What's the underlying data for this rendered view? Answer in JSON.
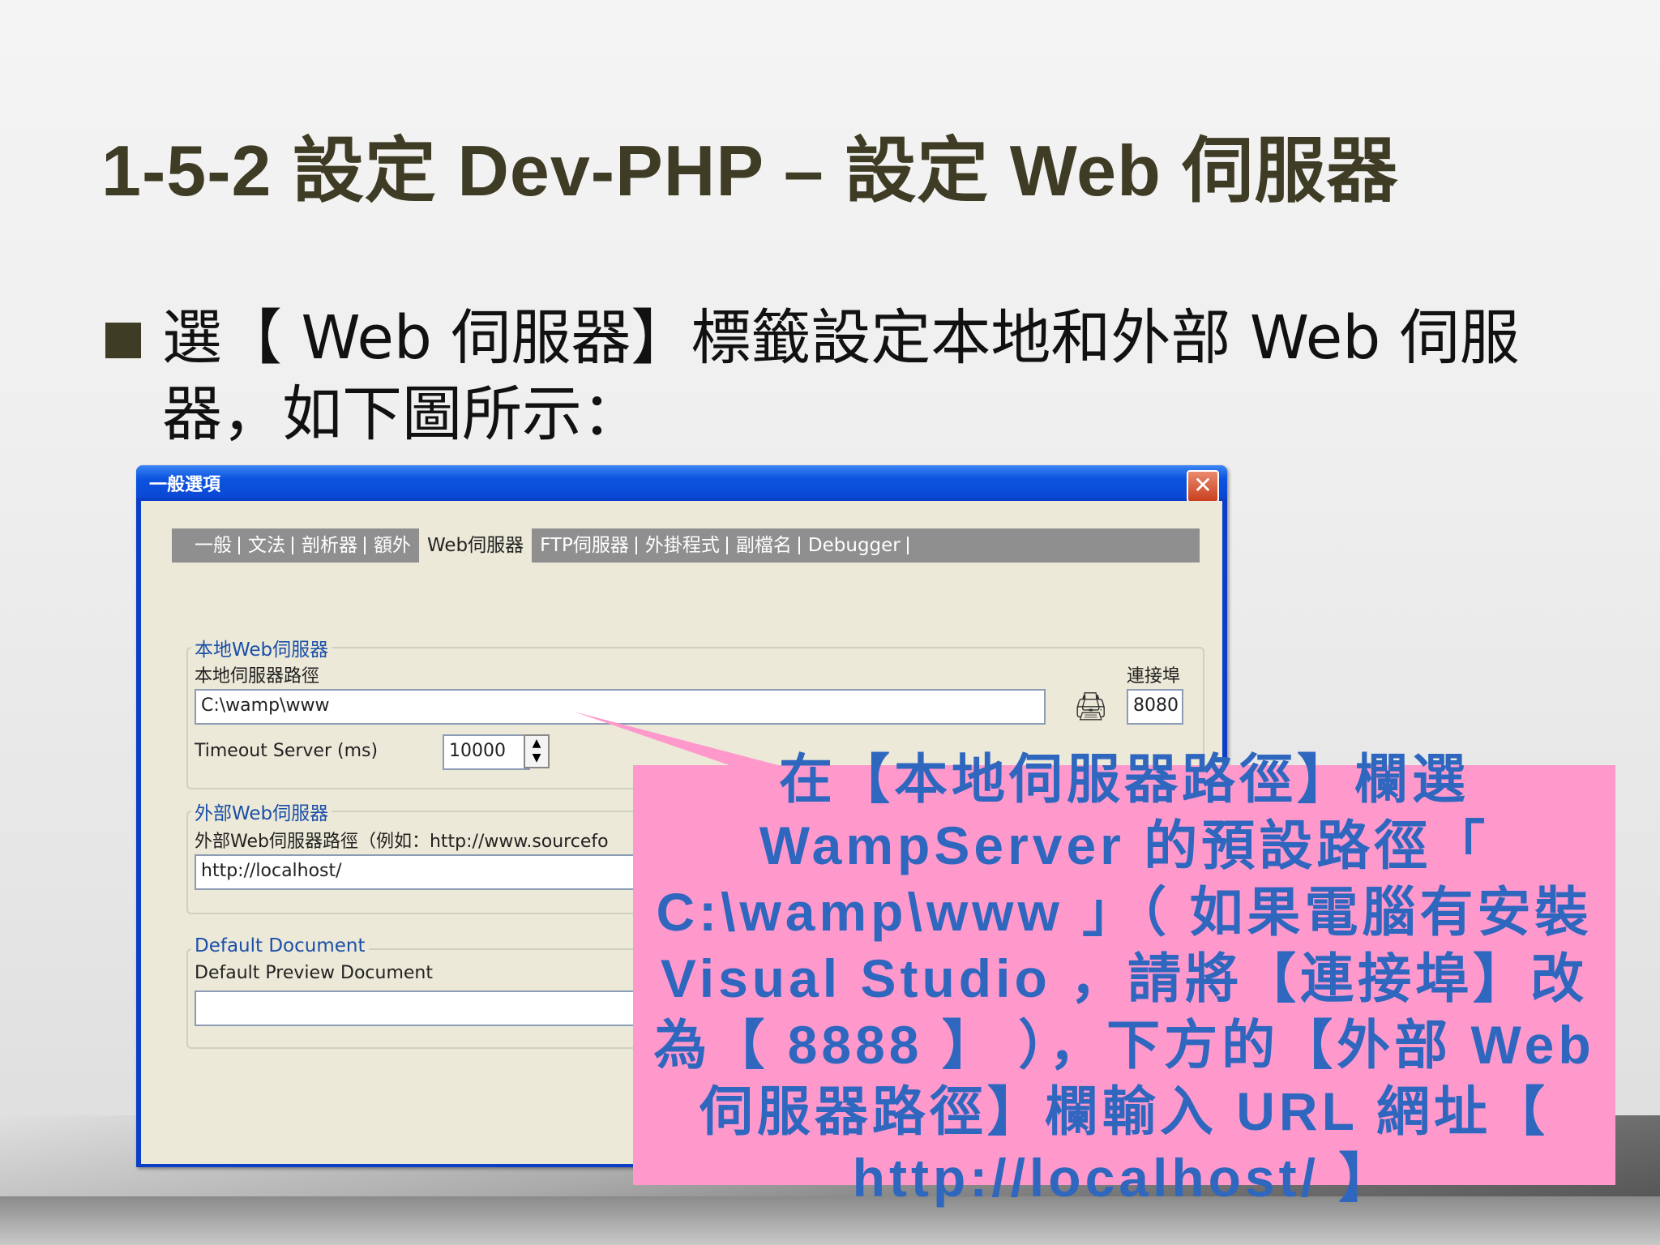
{
  "slide": {
    "title": "1-5-2  設定 Dev-PHP –  設定 Web 伺服器",
    "bullet": "選【 Web 伺服器】標籤設定本地和外部 Web 伺服器，如下圖所示："
  },
  "window": {
    "title": "一般選項",
    "close_icon": "close-icon",
    "tabs": [
      "一般",
      "文法",
      "剖析器",
      "額外",
      "Web伺服器",
      "FTP伺服器",
      "外掛程式",
      "副檔名",
      "Debugger"
    ],
    "active_tab": "Web伺服器",
    "local": {
      "legend": "本地Web伺服器",
      "path_label": "本地伺服器路徑",
      "path_value": "C:\\wamp\\www",
      "port_label": "連接埠",
      "port_value": "8080",
      "timeout_label": "Timeout Server (ms)",
      "timeout_value": "10000"
    },
    "external": {
      "legend": "外部Web伺服器",
      "path_label": "外部Web伺服器路徑（例如：http://www.sourcefo",
      "path_value": "http://localhost/"
    },
    "default_doc": {
      "legend": "Default Document",
      "preview_label": "Default Preview Document",
      "preview_value": ""
    }
  },
  "callout": {
    "text": "在【本地伺服器路徑】欄選 WampServer 的預設路徑「 C:\\wamp\\www 」（ 如果電腦有安裝 Visual Studio ，請將【連接埠】改為【 8888 】 ），下方的【外部 Web 伺服器路徑】欄輸入 URL 網址【 http://localhost/ 】",
    "color": "#ff99cc",
    "text_color": "#2f67bf"
  }
}
